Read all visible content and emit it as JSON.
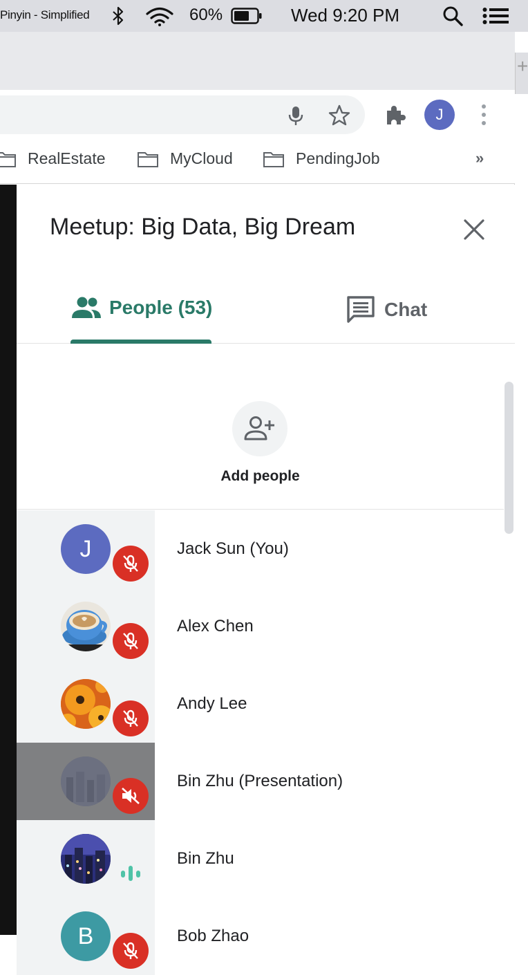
{
  "menubar": {
    "input_source": "Pinyin - Simplified",
    "battery_percent": "60%",
    "clock": "Wed 9:20 PM",
    "icons": [
      "bluetooth-icon",
      "wifi-icon",
      "battery-icon",
      "spotlight-search-icon",
      "control-center-icon"
    ]
  },
  "browser": {
    "profile_initial": "J",
    "bookmarks": [
      {
        "label": "RealEstate"
      },
      {
        "label": "MyCloud"
      },
      {
        "label": "PendingJob"
      }
    ],
    "bookmarks_more": "»"
  },
  "meet": {
    "title": "Meetup: Big Data, Big Dream",
    "tabs": {
      "people_label": "People (53)",
      "chat_label": "Chat"
    },
    "add_people_label": "Add people",
    "participants": [
      {
        "name": "Jack Sun (You)",
        "initial": "J",
        "avatar_color": "#5c6bc0",
        "status": "muted"
      },
      {
        "name": "Alex Chen",
        "initial": "",
        "avatar_image": "coffee-cup-photo",
        "status": "muted"
      },
      {
        "name": "Andy Lee",
        "initial": "",
        "avatar_image": "orange-flower-photo",
        "status": "muted"
      },
      {
        "name": "Bin Zhu (Presentation)",
        "initial": "",
        "avatar_image": "city-night-photo",
        "status": "sound-off"
      },
      {
        "name": "Bin Zhu",
        "initial": "",
        "avatar_image": "city-night-photo",
        "status": "speaking"
      },
      {
        "name": "Bob Zhao",
        "initial": "B",
        "avatar_color": "#3d9aa3",
        "status": "muted"
      }
    ]
  },
  "colors": {
    "accent": "#2a7a68",
    "mute_red": "#d93025",
    "speaking_teal": "#4fc3a7"
  }
}
